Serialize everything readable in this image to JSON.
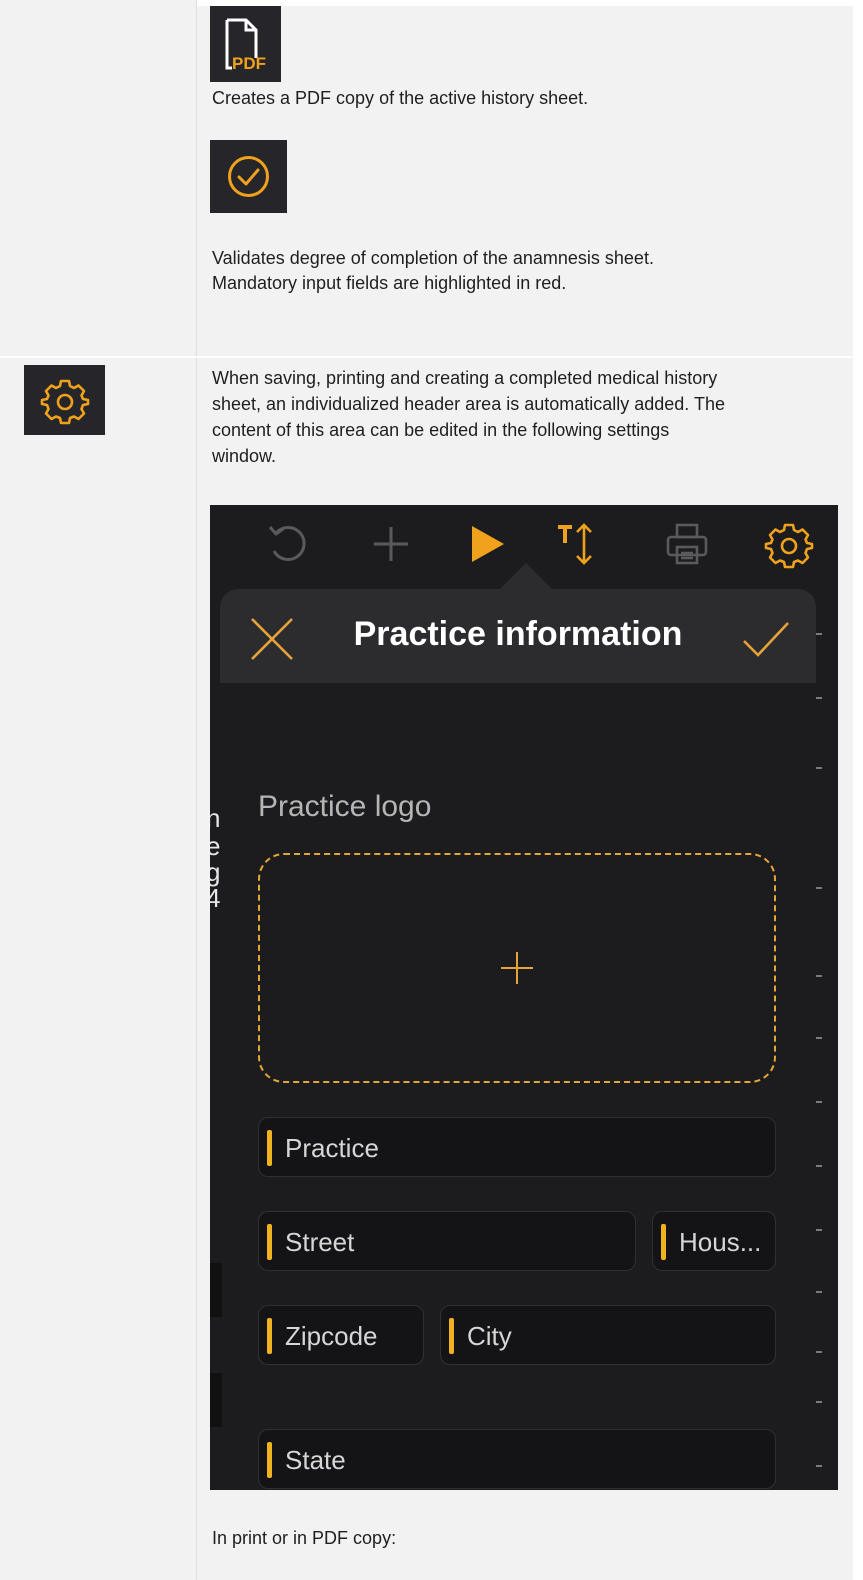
{
  "rows": [
    {
      "icon": "pdf-icon",
      "icon_text": "PDF",
      "description": "Creates a PDF copy of the active history sheet."
    },
    {
      "icon": "check-circle-icon",
      "description_line1": "Validates degree of completion of the anamnesis sheet.",
      "description_line2": "Mandatory input fields are highlighted in red."
    },
    {
      "icon": "gear-icon",
      "description_lines": [
        "When saving, printing and creating a completed medical history",
        "sheet, an individualized header area is automatically added. The",
        "content of this area can be edited in the following settings",
        "window."
      ],
      "footer_text": "In print or in PDF copy:"
    }
  ],
  "screenshot": {
    "toolbar_icons": [
      "undo-icon",
      "plus-icon",
      "play-icon",
      "text-size-icon",
      "print-icon",
      "gear-icon"
    ],
    "title": "Practice information",
    "logo_label": "Practice logo",
    "left_fragments": [
      "n",
      "e",
      "g",
      "4"
    ],
    "fields": {
      "practice": "Practice",
      "street": "Street",
      "house": "Hous...",
      "zipcode": "Zipcode",
      "city": "City",
      "state": "State"
    },
    "accent_color": "#f0b21f",
    "background_color": "#1c1c1e"
  }
}
